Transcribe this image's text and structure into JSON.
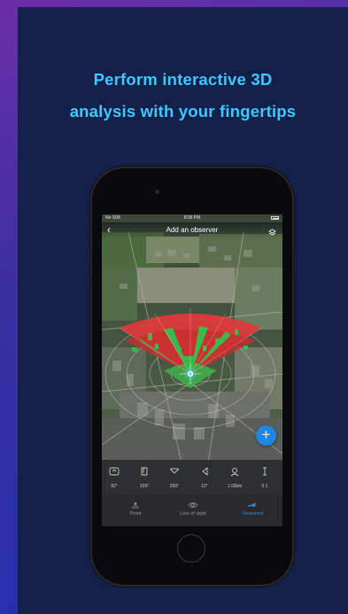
{
  "headline": {
    "line1": "Perform interactive 3D",
    "line2": "analysis with your fingertips"
  },
  "status_bar": {
    "left": "No SIM",
    "time": "8:06 PM"
  },
  "nav": {
    "back_icon": "chevron-left-icon",
    "title": "Add an observer",
    "layers_icon": "layers-icon"
  },
  "fab": {
    "label": "+"
  },
  "tools": [
    {
      "icon": "heading-icon",
      "value": "92°"
    },
    {
      "icon": "pitch-icon",
      "value": "159°"
    },
    {
      "icon": "horizontal-fov-icon",
      "value": "250°"
    },
    {
      "icon": "vertical-fov-icon",
      "value": "12°"
    },
    {
      "icon": "distance-icon",
      "value": "1.02km"
    },
    {
      "icon": "offset-icon",
      "value": "0.1"
    }
  ],
  "tabs": [
    {
      "icon": "point-icon",
      "label": "Point",
      "active": false
    },
    {
      "icon": "line-of-sight-icon",
      "label": "Line of sight",
      "active": false
    },
    {
      "icon": "viewshed-icon",
      "label": "Viewshed",
      "active": true
    }
  ],
  "colors": {
    "headline": "#3ec8ff",
    "panel": "#13204a",
    "visible": "#3db84a",
    "not_visible": "#e23a3a",
    "accent": "#2c88e0"
  }
}
